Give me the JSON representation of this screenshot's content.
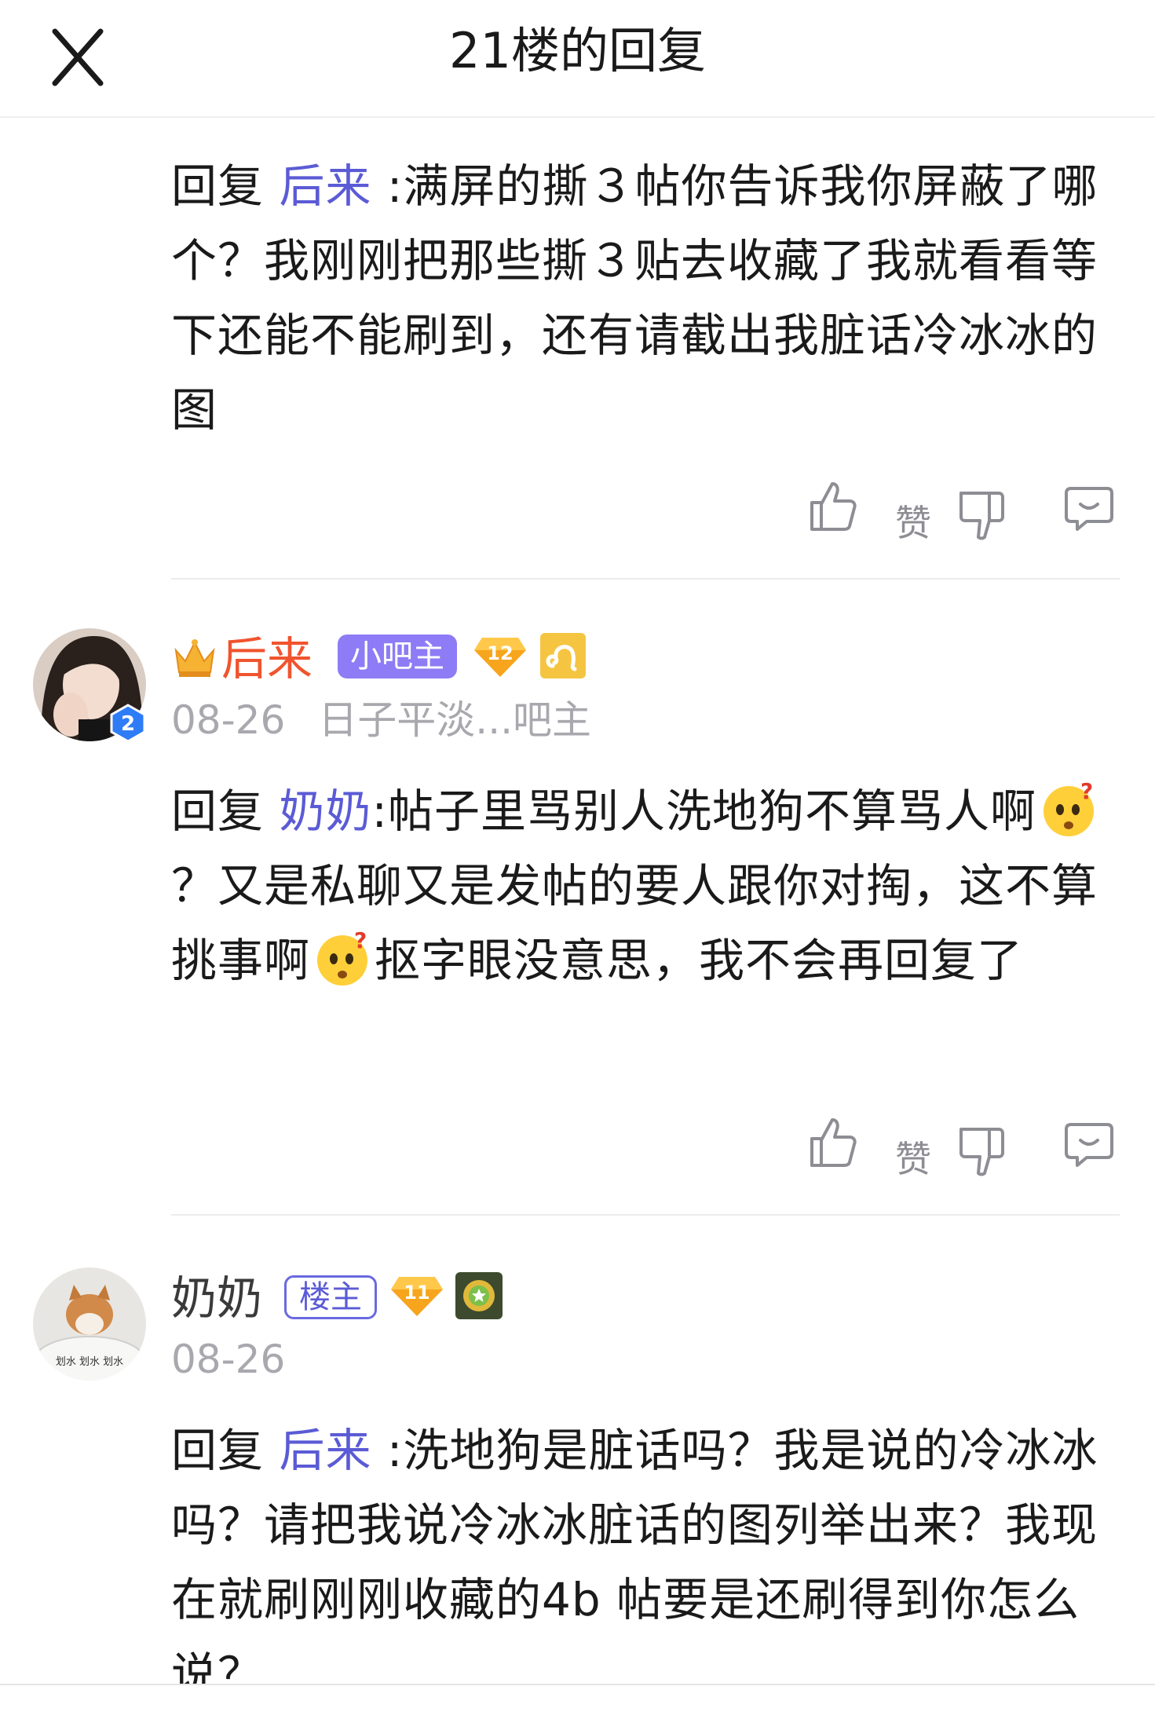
{
  "header": {
    "title": "21楼的回复",
    "close_icon": "close-icon"
  },
  "colors": {
    "mention": "#5b5bd6",
    "username_red": "#f0542e",
    "meta_gray": "#a8a8ae",
    "tag_purple": "#8d7cf5"
  },
  "replies": [
    {
      "reply_prefix": "回复",
      "mention": "后来",
      "text": ":满屏的撕３帖你告诉我你屏蔽了哪个？我刚刚把那些撕３贴去收藏了我就看看等下还能不能刷到，还有请截出我脏话冷冰冰的图",
      "actions": {
        "like_label": "赞"
      }
    },
    {
      "user": {
        "name": "后来",
        "crown_icon": "crown-icon",
        "role_tag": "小吧主",
        "level": "12",
        "extra_badge_icon": "leo-zodiac-icon",
        "avatar_badge": "2"
      },
      "date": "08-26",
      "signature": "日子平淡...吧主",
      "reply_prefix": "回复",
      "mention": "奶奶",
      "text_parts": [
        ":帖子里骂别人洗地狗不算骂人啊",
        "？又是私聊又是发帖的要人跟你对掏，这不算挑事啊",
        "抠字眼没意思，我不会再回复了"
      ],
      "emoji": "confused-face-emoji",
      "actions": {
        "like_label": "赞"
      }
    },
    {
      "user": {
        "name": "奶奶",
        "role_tag": "楼主",
        "level": "11",
        "extra_badge_icon": "star-medal-icon",
        "avatar_caption": "划水 划水 划水"
      },
      "date": "08-26",
      "reply_prefix": "回复",
      "mention": "后来",
      "text": ":洗地狗是脏话吗？我是说的冷冰冰吗？请把我说冷冰冰脏话的图列举出来？我现在就刷刚刚收藏的4b 帖要是还刷得到你怎么说？"
    }
  ]
}
